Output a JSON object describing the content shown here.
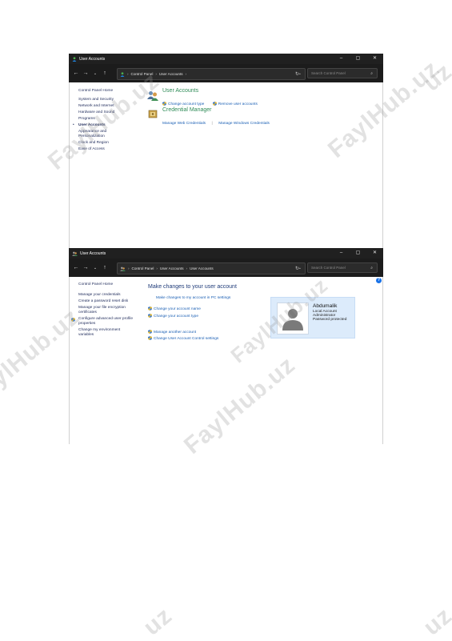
{
  "window1": {
    "title": "User Accounts",
    "controls": {
      "minimize": "–",
      "maximize": "▢",
      "close": "✕"
    },
    "nav": {
      "back": "←",
      "forward": "→",
      "recent": "⌄",
      "up": "↑"
    },
    "breadcrumb": [
      "Control Panel",
      "User Accounts"
    ],
    "search_placeholder": "Search Control Panel",
    "sidebar": {
      "home": "Control Panel Home",
      "items": [
        "System and Security",
        "Network and Internet",
        "Hardware and Sound",
        "Programs",
        "User Accounts",
        "Appearance and Personalization",
        "Clock and Region",
        "Ease of Access"
      ],
      "selected": "User Accounts"
    },
    "sections": [
      {
        "heading": "User Accounts",
        "icon": "users-icon",
        "links": [
          "Change account type",
          "Remove user accounts"
        ]
      },
      {
        "heading": "Credential Manager",
        "icon": "vault-icon",
        "links": [
          "Manage Web Credentials",
          "Manage Windows Credentials"
        ]
      }
    ]
  },
  "window2": {
    "title": "User Accounts",
    "controls": {
      "minimize": "–",
      "maximize": "▢",
      "close": "✕"
    },
    "nav": {
      "back": "←",
      "forward": "→",
      "recent": "⌄",
      "up": "↑"
    },
    "breadcrumb": [
      "Control Panel",
      "User Accounts",
      "User Accounts"
    ],
    "search_placeholder": "Search Control Panel",
    "sidebar": {
      "home": "Control Panel Home",
      "items": [
        "Manage your credentials",
        "Create a password reset disk",
        "Manage your file encryption certificates",
        "Configure advanced user profile properties",
        "Change my environment variables"
      ]
    },
    "main": {
      "heading": "Make changes to your user account",
      "pc_settings_link": "Make changes to my account in PC settings",
      "links_group1": [
        "Change your account name",
        "Change your account type"
      ],
      "links_group2": [
        "Manage another account",
        "Change User Account Control settings"
      ]
    },
    "account": {
      "name": "Abdumalik",
      "details": [
        "Local Account",
        "Administrator",
        "Password protected"
      ]
    },
    "help": "?"
  },
  "watermarks": [
    "FaylHub.uz",
    "FaylHub.uz",
    "FaylHub.uz",
    "FaylHub.uz",
    "FaylHub.uz",
    "uz",
    "uz",
    "uz"
  ],
  "colors": {
    "titlebar": "#202020",
    "navbar": "#1c1c1c",
    "heading": "#2e8b57",
    "link": "#1a5fb4",
    "card": "#dcebfb"
  }
}
